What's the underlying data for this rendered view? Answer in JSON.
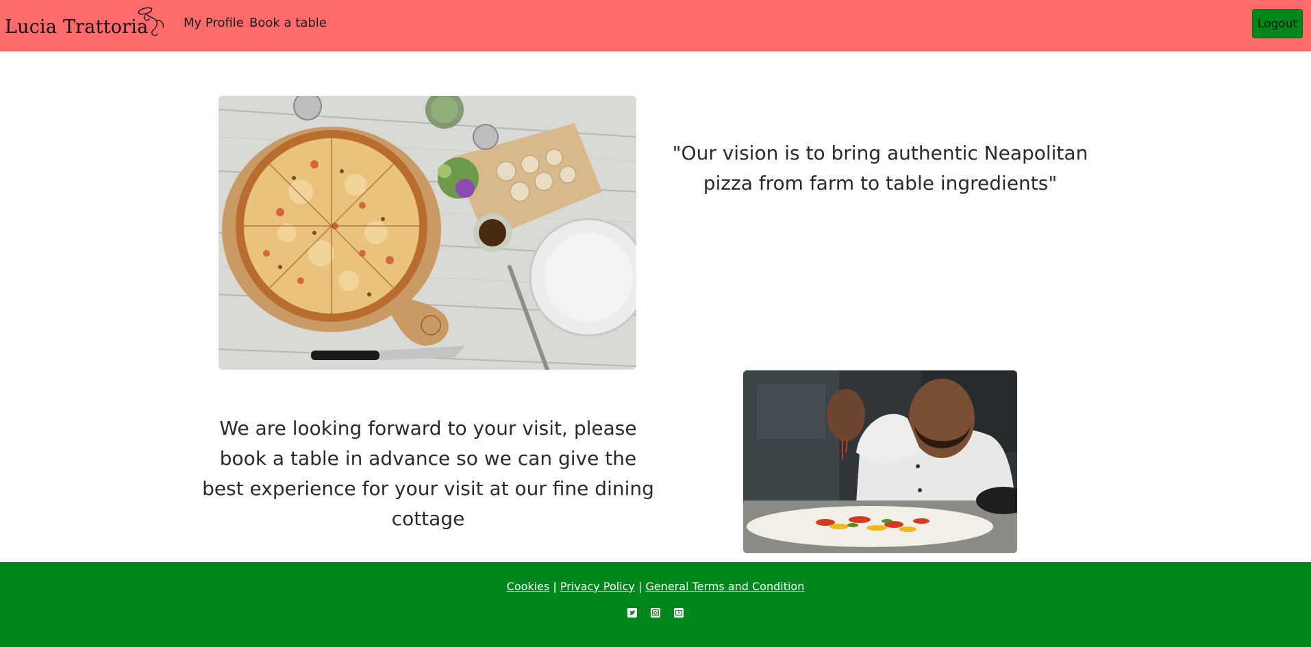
{
  "nav": {
    "brand": "Lucia Trattoria",
    "links": [
      "My Profile",
      "Book a table"
    ],
    "logout_label": "Logout"
  },
  "main": {
    "vision_quote": "\"Our vision is to bring authentic Neapolitan pizza from farm to table ingredients\"",
    "visit_text": "We are looking forward to your visit, please book a table in advance so we can give the best experience for your visit at our fine dining cottage",
    "images": [
      "pizza-table-photo",
      "chef-seasoning-photo"
    ]
  },
  "footer": {
    "links": [
      "Cookies",
      "Privacy Policy",
      "General Terms and Condition"
    ],
    "separator": " | ",
    "socials": [
      "twitter-icon",
      "instagram-icon",
      "youtube-icon"
    ]
  },
  "colors": {
    "navbar": "#ff6b6b",
    "footer": "#00871c",
    "logout_button": "#00871c"
  }
}
